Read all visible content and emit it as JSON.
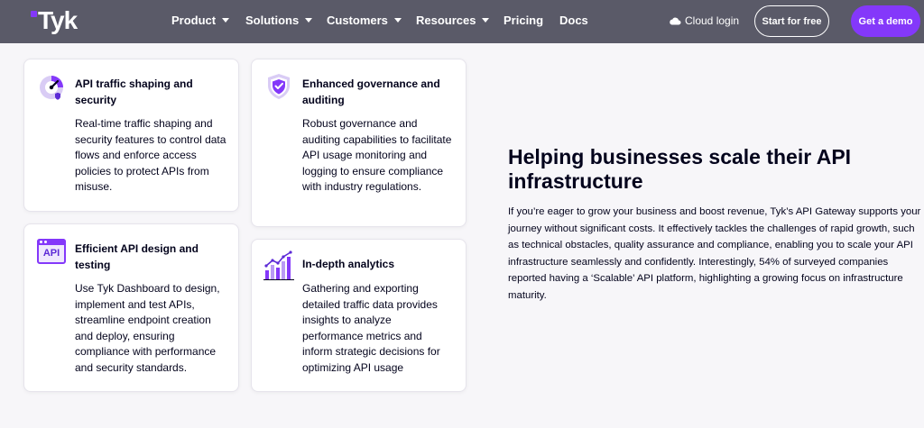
{
  "nav": {
    "logo": "Tyk",
    "items": [
      {
        "label": "Product",
        "dropdown": true
      },
      {
        "label": "Solutions",
        "dropdown": true
      },
      {
        "label": "Customers",
        "dropdown": true
      },
      {
        "label": "Resources",
        "dropdown": true
      },
      {
        "label": "Pricing",
        "dropdown": false
      },
      {
        "label": "Docs",
        "dropdown": false
      }
    ],
    "cloud_login": "Cloud login",
    "start_free": "Start for free",
    "get_demo": "Get a demo"
  },
  "cards": [
    {
      "icon": "gauge-icon",
      "title": "API traffic shaping and security",
      "body": "Real-time traffic shaping and security features to control data flows and enforce access policies to protect APIs from misuse."
    },
    {
      "icon": "shield-check-icon",
      "title": "Enhanced governance and auditing",
      "body": "Robust governance and auditing capabilities to facilitate API usage monitoring and logging to ensure compliance with industry regulations."
    },
    {
      "icon": "api-window-icon",
      "icon_label": "API",
      "title": "Efficient API design and testing",
      "body": "Use Tyk Dashboard to design, implement and test APIs, streamline endpoint creation and deploy, ensuring compliance with performance and security standards."
    },
    {
      "icon": "bar-chart-icon",
      "title": "In-depth analytics",
      "body": "Gathering and exporting detailed traffic data provides insights to analyze performance metrics and inform strategic decisions for optimizing API usage"
    }
  ],
  "hero": {
    "headline": "Helping businesses scale their API infrastructure",
    "paragraph": "If you’re eager to grow your business and boost revenue, Tyk’s API Gateway supports your journey without significant costs. It effectively tackles the challenges of rapid growth, such as technical obstacles, quality assurance and compliance, enabling you to scale your API infrastructure seamlessly and confidently. Interestingly, 54% of surveyed companies reported having a ‘Scalable’ API platform, highlighting a growing focus on infrastructure maturity."
  },
  "colors": {
    "brand_purple": "#8438fa",
    "nav_bg": "#5a5a68",
    "page_bg": "#f7f6f9",
    "text_dark": "#03031c"
  }
}
